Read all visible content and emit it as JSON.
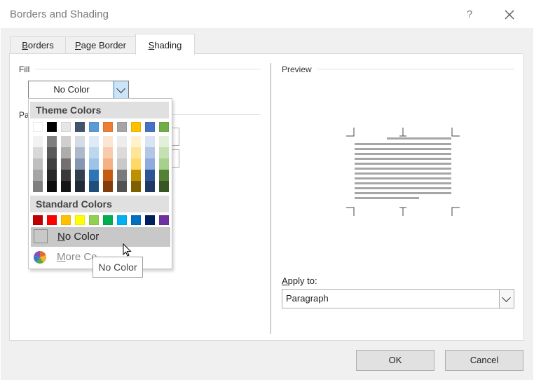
{
  "window": {
    "title": "Borders and Shading",
    "help_label": "?"
  },
  "tabs": [
    {
      "label": "Borders",
      "mnemonic": "B",
      "rest": "orders"
    },
    {
      "label": "Page Border",
      "mnemonic": "P",
      "rest": "age Border"
    },
    {
      "label": "Shading",
      "mnemonic": "S",
      "rest": "hading"
    }
  ],
  "active_tab": "Shading",
  "fill": {
    "label": "Fill",
    "value": "No Color"
  },
  "pattern": {
    "label_visible": "Pa"
  },
  "color_menu": {
    "theme_heading": "Theme Colors",
    "standard_heading": "Standard Colors",
    "theme_row": [
      "#ffffff",
      "#000000",
      "#e7e6e6",
      "#44546a",
      "#5b9bd5",
      "#ed7d31",
      "#a5a5a5",
      "#ffc000",
      "#4472c4",
      "#70ad47"
    ],
    "theme_shades": [
      [
        "#f2f2f2",
        "#7f7f7f",
        "#d0cece",
        "#d6dce4",
        "#deebf6",
        "#fbe5d5",
        "#ededed",
        "#fff2cc",
        "#dae3f3",
        "#e2efd9"
      ],
      [
        "#d8d8d8",
        "#595959",
        "#aeabab",
        "#adb9ca",
        "#bdd7ee",
        "#f7cbac",
        "#dbdbdb",
        "#fee599",
        "#b4c6e7",
        "#c5e0b3"
      ],
      [
        "#bfbfbf",
        "#3f3f3f",
        "#757070",
        "#8496b0",
        "#9dc3e6",
        "#f4b183",
        "#c9c9c9",
        "#ffd965",
        "#8faadc",
        "#a8d08d"
      ],
      [
        "#a5a5a5",
        "#262626",
        "#3a3838",
        "#323f4f",
        "#2e75b5",
        "#c55a11",
        "#7b7b7b",
        "#bf9000",
        "#2f5496",
        "#538135"
      ],
      [
        "#7f7f7f",
        "#0c0c0c",
        "#171616",
        "#222a35",
        "#1e4e79",
        "#833c0b",
        "#525252",
        "#7f6000",
        "#1f3864",
        "#375623"
      ]
    ],
    "standard_row": [
      "#c00000",
      "#ff0000",
      "#ffc000",
      "#ffff00",
      "#92d050",
      "#00b050",
      "#00b0f0",
      "#0070c0",
      "#002060",
      "#7030a0"
    ],
    "no_color_label": "No Color",
    "more_colors_label": "More Co",
    "tooltip": "No Color"
  },
  "preview": {
    "label": "Preview",
    "apply_to_label": "Apply to:",
    "apply_to_value": "Paragraph"
  },
  "buttons": {
    "ok": "OK",
    "cancel": "Cancel"
  }
}
